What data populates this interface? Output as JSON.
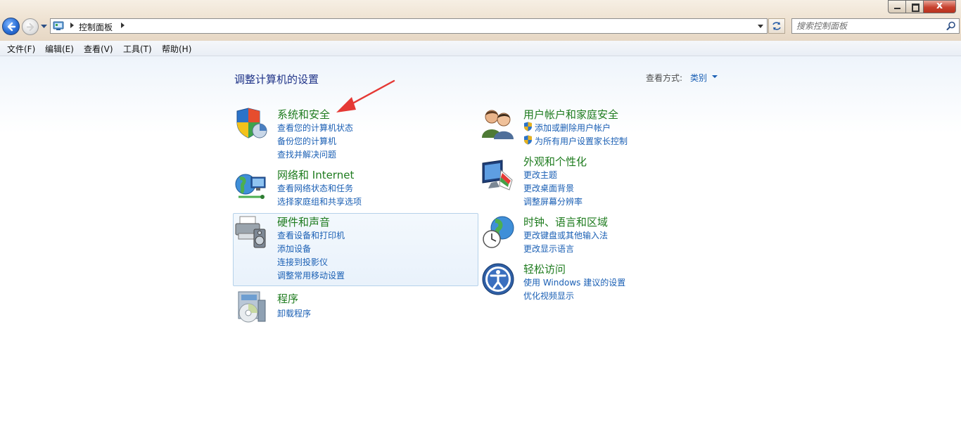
{
  "addressbar": {
    "crumb": "控制面板",
    "search_placeholder": "搜索控制面板"
  },
  "menu": {
    "items": [
      "文件(F)",
      "编辑(E)",
      "查看(V)",
      "工具(T)",
      "帮助(H)"
    ]
  },
  "window_controls": {
    "close_glyph": "x"
  },
  "header": {
    "title": "调整计算机的设置",
    "view_by_label": "查看方式:",
    "view_by_value": "类别"
  },
  "categories": {
    "system_security": {
      "title": "系统和安全",
      "links": [
        "查看您的计算机状态",
        "备份您的计算机",
        "查找并解决问题"
      ]
    },
    "network": {
      "title": "网络和 Internet",
      "links": [
        "查看网络状态和任务",
        "选择家庭组和共享选项"
      ]
    },
    "hardware": {
      "title": "硬件和声音",
      "links": [
        "查看设备和打印机",
        "添加设备",
        "连接到投影仪",
        "调整常用移动设置"
      ]
    },
    "programs": {
      "title": "程序",
      "links": [
        "卸载程序"
      ]
    },
    "user_accounts": {
      "title": "用户帐户和家庭安全",
      "links": [
        "添加或删除用户帐户",
        "为所有用户设置家长控制"
      ]
    },
    "appearance": {
      "title": "外观和个性化",
      "links": [
        "更改主题",
        "更改桌面背景",
        "调整屏幕分辨率"
      ]
    },
    "clock": {
      "title": "时钟、语言和区域",
      "links": [
        "更改键盘或其他输入法",
        "更改显示语言"
      ]
    },
    "ease_access": {
      "title": "轻松访问",
      "links": [
        "使用 Windows 建议的设置",
        "优化视频显示"
      ]
    }
  },
  "colors": {
    "category_title": "#1e7b1e",
    "link": "#1a5fb4",
    "page_title": "#1e3287",
    "annotation_arrow": "#e53935"
  }
}
